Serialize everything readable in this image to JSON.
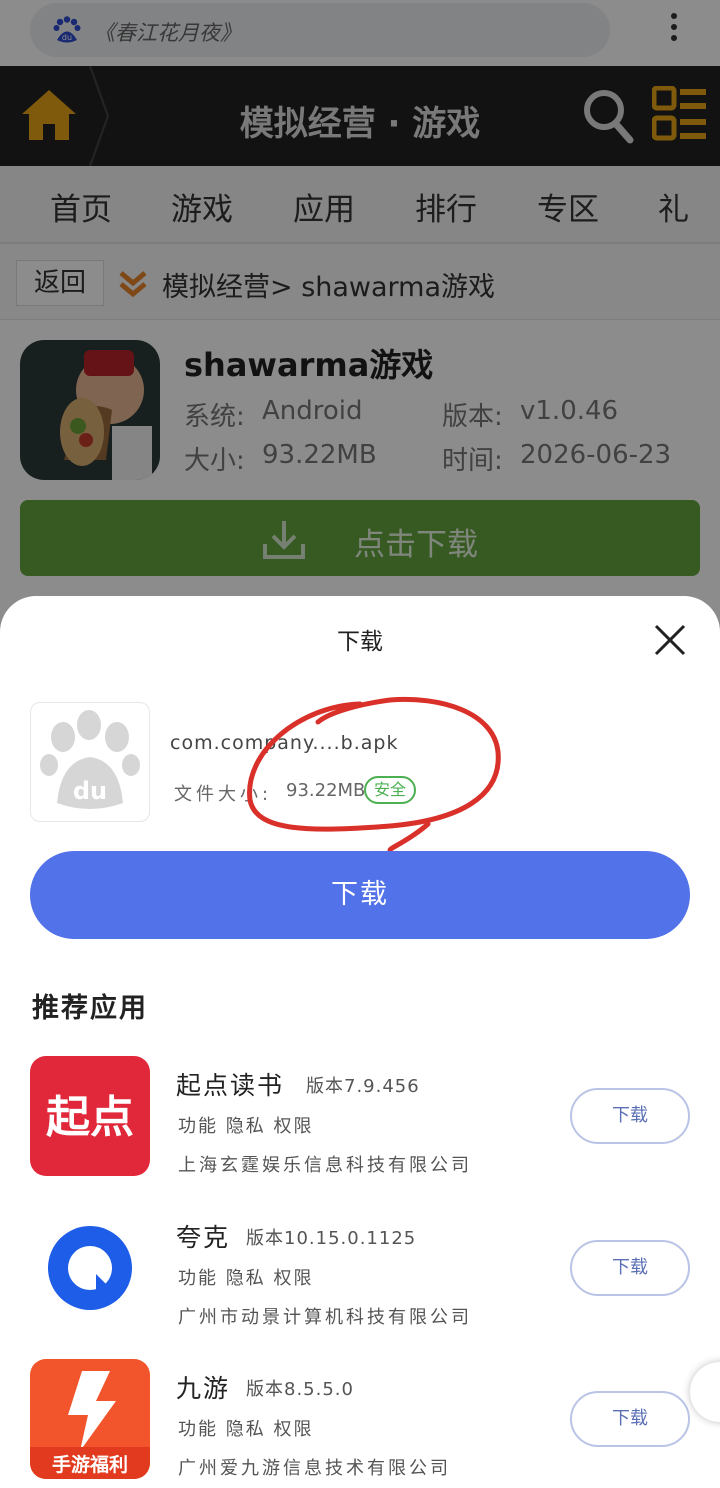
{
  "browser": {
    "url_text": "《春江花月夜》"
  },
  "topbar": {
    "title": "模拟经营 · 游戏"
  },
  "nav": {
    "tabs": [
      "首页",
      "游戏",
      "应用",
      "排行",
      "专区",
      "礼"
    ]
  },
  "breadcrumb": {
    "back_label": "返回",
    "path": "模拟经营> shawarma游戏"
  },
  "app": {
    "name": "shawarma游戏",
    "system_label": "系统:",
    "system": "Android",
    "version_label": "版本:",
    "version": "v1.0.46",
    "size_label": "大小:",
    "size": "93.22MB",
    "time_label": "时间:",
    "time": "2026-06-23",
    "download_label": "点击下载"
  },
  "sheet": {
    "title": "下载",
    "file_name": "com.company....b.apk",
    "file_size_label": "文件大小:",
    "file_size": "93.22MB",
    "safe_badge": "安全",
    "download_button": "下载",
    "recommend_title": "推荐应用"
  },
  "recommended": [
    {
      "name": "起点读书",
      "version": "版本7.9.456",
      "permissions": "功能 隐私 权限",
      "company": "上海玄霆娱乐信息科技有限公司",
      "button": "下载",
      "icon_text": "起点",
      "icon_color": "#e0283a"
    },
    {
      "name": "夸克",
      "version": "版本10.15.0.1125",
      "permissions": "功能 隐私 权限",
      "company": "广州市动景计算机科技有限公司",
      "button": "下载",
      "icon_color": "#1d5de8"
    },
    {
      "name": "九游",
      "version": "版本8.5.5.0",
      "permissions": "功能 隐私 权限",
      "company": "广州爱九游信息技术有限公司",
      "button": "下载",
      "icon_text": "手游福利",
      "icon_color": "#f2542b"
    }
  ],
  "colors": {
    "accent_blue": "#5272e9",
    "download_green": "#63a53c",
    "safe_green": "#4caf50",
    "brand_orange": "#e8a317",
    "annotation_red": "#d9302a"
  },
  "icons": [
    "baidu-du-icon",
    "kebab-menu-icon",
    "home-icon",
    "search-icon",
    "list-menu-icon",
    "double-chevron-icon",
    "download-icon",
    "close-icon",
    "baidu-paw-icon"
  ]
}
